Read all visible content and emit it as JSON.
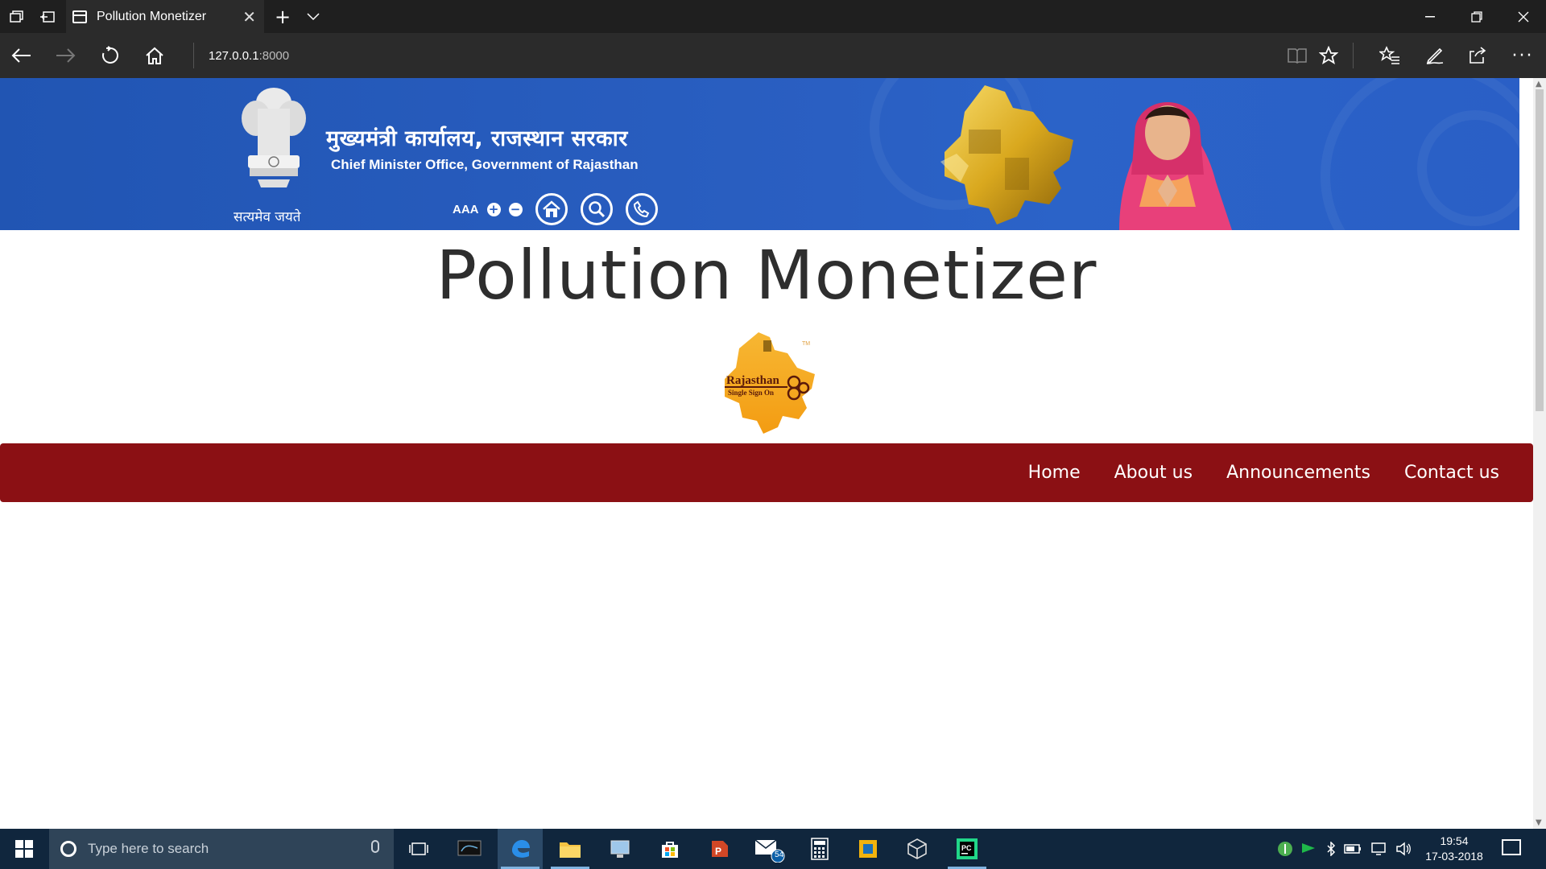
{
  "browser": {
    "tab_title": "Pollution Monetizer",
    "address_host": "127.0.0.1",
    "address_port": ":8000",
    "icons": [
      "tab-manager-icon",
      "set-aside-icon",
      "page-icon",
      "close-tab-icon",
      "new-tab-icon",
      "tab-list-icon",
      "minimize-icon",
      "restore-icon",
      "close-window-icon",
      "back-icon",
      "forward-icon",
      "refresh-icon",
      "home-icon",
      "reading-view-icon",
      "favorite-star-icon",
      "favorites-hub-icon",
      "web-note-icon",
      "share-icon",
      "more-icon"
    ]
  },
  "banner": {
    "hindi_title": "मुख्यमंत्री कार्यालय, राजस्थान सरकार",
    "english_title": "Chief Minister Office, Government of Rajasthan",
    "motto": "सत्यमेव जयते",
    "font_resize_label": "AAA",
    "tools": [
      "font-increase-icon",
      "font-decrease-icon",
      "home-circle-icon",
      "search-circle-icon",
      "phone-circle-icon"
    ]
  },
  "site": {
    "title": "Pollution Monetizer",
    "logo_text_main": "Rajasthan",
    "logo_text_sub": "Single Sign On",
    "logo_tm": "TM"
  },
  "menu": {
    "items": [
      "Home",
      "About us",
      "Announcements",
      "Contact us"
    ]
  },
  "taskbar": {
    "search_placeholder": "Type here to search",
    "time": "19:54",
    "date": "17-03-2018",
    "mail_badge": "54",
    "apps": [
      "task-view-icon",
      "mysql-icon",
      "edge-icon",
      "file-explorer-icon",
      "remote-desktop-icon",
      "store-icon",
      "powerpoint-icon",
      "mail-icon",
      "calculator-icon",
      "virtualbox-icon",
      "box-icon",
      "pycharm-icon"
    ]
  },
  "colors": {
    "banner_blue": "#2a5fc2",
    "menu_red": "#8b1014",
    "title_dark": "#2e2e2e",
    "taskbar": "#10263d"
  }
}
